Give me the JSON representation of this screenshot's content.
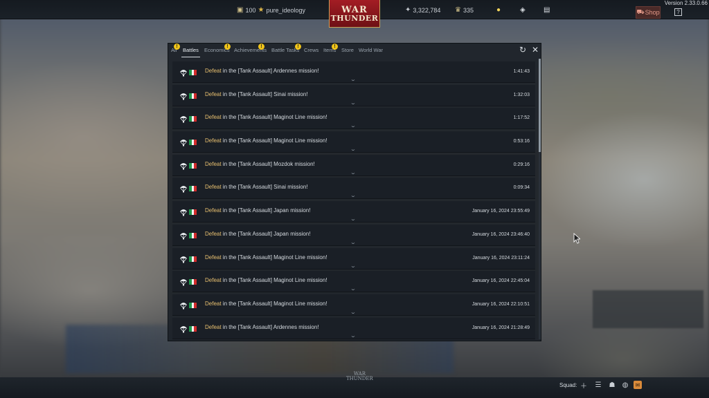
{
  "version": "Version 2.33.0.66",
  "topbar": {
    "rank_value": "100",
    "username": "pure_ideology",
    "logo_line1": "WAR",
    "logo_line2": "THUNDER",
    "silver_lions": "3,322,784",
    "golden_eagles": "335",
    "shop_label": "Shop",
    "help_label": "?"
  },
  "panel": {
    "tabs": [
      {
        "label": "All",
        "badge": "!"
      },
      {
        "label": "Battles",
        "active": true
      },
      {
        "label": "Economics",
        "badge": "!"
      },
      {
        "label": "Achievements",
        "badge": "!"
      },
      {
        "label": "Battle Tasks",
        "badge": "!"
      },
      {
        "label": "Crews"
      },
      {
        "label": "Items",
        "badge": "!"
      },
      {
        "label": "Store"
      },
      {
        "label": "World War"
      }
    ],
    "rows": [
      {
        "result": "Defeat",
        "text": " in the [Tank Assault] Ardennes mission!",
        "time": "1:41:43"
      },
      {
        "result": "Defeat",
        "text": " in the [Tank Assault] Sinai mission!",
        "time": "1:32:03"
      },
      {
        "result": "Defeat",
        "text": " in the [Tank Assault] Maginot Line mission!",
        "time": "1:17:52"
      },
      {
        "result": "Defeat",
        "text": " in the [Tank Assault] Maginot Line mission!",
        "time": "0:53:16"
      },
      {
        "result": "Defeat",
        "text": " in the [Tank Assault] Mozdok mission!",
        "time": "0:29:16"
      },
      {
        "result": "Defeat",
        "text": " in the [Tank Assault] Sinai mission!",
        "time": "0:09:34"
      },
      {
        "result": "Defeat",
        "text": " in the [Tank Assault] Japan mission!",
        "time": "January 16, 2024 23:55:49"
      },
      {
        "result": "Defeat",
        "text": " in the [Tank Assault] Japan mission!",
        "time": "January 16, 2024 23:46:40"
      },
      {
        "result": "Defeat",
        "text": " in the [Tank Assault] Maginot Line mission!",
        "time": "January 16, 2024 23:11:24"
      },
      {
        "result": "Defeat",
        "text": " in the [Tank Assault] Maginot Line mission!",
        "time": "January 16, 2024 22:45:04"
      },
      {
        "result": "Defeat",
        "text": " in the [Tank Assault] Maginot Line mission!",
        "time": "January 16, 2024 22:10:51"
      },
      {
        "result": "Defeat",
        "text": " in the [Tank Assault] Ardennes mission!",
        "time": "January 16, 2024 21:28:49"
      }
    ],
    "scroll_fraction": 0
  },
  "bottombar": {
    "logo_line1": "WAR",
    "logo_line2": "THUNDER",
    "squad_label": "Squad:"
  },
  "colors": {
    "result_defeat": "#e8c070",
    "badge": "#f0c419",
    "flag_italy": [
      "#1f9a4c",
      "#f4f4f4",
      "#d22b2b"
    ]
  },
  "icons": {
    "row": [
      "parachute-icon",
      "italy-flag-icon"
    ],
    "panel": [
      "refresh-icon",
      "close-icon"
    ],
    "topbar": [
      "rank-icon",
      "premium-star-icon",
      "silver-lions-icon",
      "golden-eagles-icon",
      "lightbulb-icon",
      "profile-icon",
      "items-icon",
      "cart-icon",
      "help-icon"
    ],
    "bottombar": [
      "add-icon",
      "list-icon",
      "contacts-icon",
      "chat-icon",
      "mail-icon"
    ]
  }
}
